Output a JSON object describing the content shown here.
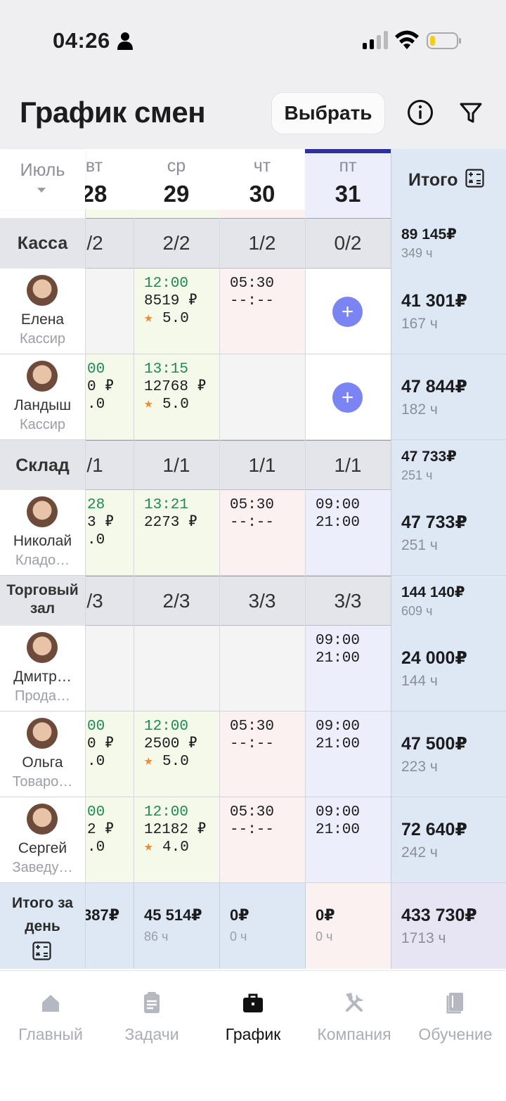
{
  "status_bar": {
    "time": "04:26"
  },
  "header": {
    "title": "График смен",
    "select_label": "Выбрать"
  },
  "month": {
    "label": "Июль"
  },
  "days": [
    {
      "name": "вт",
      "num": "28"
    },
    {
      "name": "ср",
      "num": "29"
    },
    {
      "name": "чт",
      "num": "30"
    },
    {
      "name": "пт",
      "num": "31"
    }
  ],
  "total_header": "Итого",
  "sections": [
    {
      "name": "Касса",
      "ratios": [
        "/2",
        "2/2",
        "1/2",
        "0/2"
      ],
      "total_sum": "89 145₽",
      "total_hours": "349 ч",
      "employees": [
        {
          "name": "Елена",
          "role": "Кассир",
          "cells": [
            {
              "lines": []
            },
            {
              "time": "12:00",
              "lines": [
                "8519 ₽"
              ],
              "rating": "5.0"
            },
            {
              "time_plain": "05:30",
              "lines": [
                "--:--"
              ]
            },
            {
              "add": "+"
            }
          ],
          "total_sum": "41 301₽",
          "total_hours": "167 ч"
        },
        {
          "name": "Ландыш",
          "role": "Кассир",
          "cells": [
            {
              "time": "00",
              "lines": [
                "0 ₽",
                ".0"
              ]
            },
            {
              "time": "13:15",
              "lines": [
                "12768 ₽"
              ],
              "rating": "5.0"
            },
            {
              "lines": []
            },
            {
              "add": "+"
            }
          ],
          "total_sum": "47 844₽",
          "total_hours": "182 ч"
        }
      ]
    },
    {
      "name": "Склад",
      "ratios": [
        "/1",
        "1/1",
        "1/1",
        "1/1"
      ],
      "total_sum": "47 733₽",
      "total_hours": "251 ч",
      "employees": [
        {
          "name": "Николай",
          "role": "Кладо…",
          "cells": [
            {
              "time": "28",
              "lines": [
                "3 ₽",
                ".0"
              ]
            },
            {
              "time": "13:21",
              "lines": [
                "2273 ₽"
              ]
            },
            {
              "time_plain": "05:30",
              "lines": [
                "--:--"
              ]
            },
            {
              "time_plain": "09:00",
              "lines": [
                "21:00"
              ]
            }
          ],
          "total_sum": "47 733₽",
          "total_hours": "251 ч"
        }
      ]
    },
    {
      "name": "Торговый зал",
      "ratios": [
        "/3",
        "2/3",
        "3/3",
        "3/3"
      ],
      "total_sum": "144 140₽",
      "total_hours": "609 ч",
      "employees": [
        {
          "name": "Дмитр…",
          "role": "Прода…",
          "cells": [
            {
              "lines": []
            },
            {
              "lines": []
            },
            {
              "lines": []
            },
            {
              "time_plain": "09:00",
              "lines": [
                "21:00"
              ]
            }
          ],
          "total_sum": "24 000₽",
          "total_hours": "144 ч"
        },
        {
          "name": "Ольга",
          "role": "Товаро…",
          "cells": [
            {
              "time": "00",
              "lines": [
                "0 ₽",
                ".0"
              ]
            },
            {
              "time": "12:00",
              "lines": [
                "2500 ₽"
              ],
              "rating": "5.0"
            },
            {
              "time_plain": "05:30",
              "lines": [
                "--:--"
              ]
            },
            {
              "time_plain": "09:00",
              "lines": [
                "21:00"
              ]
            }
          ],
          "total_sum": "47 500₽",
          "total_hours": "223 ч"
        },
        {
          "name": "Сергей",
          "role": "Заведу…",
          "cells": [
            {
              "time": "00",
              "lines": [
                "2 ₽",
                ".0"
              ]
            },
            {
              "time": "12:00",
              "lines": [
                "12182 ₽"
              ],
              "rating": "4.0"
            },
            {
              "time_plain": "05:30",
              "lines": [
                "--:--"
              ]
            },
            {
              "time_plain": "09:00",
              "lines": [
                "21:00"
              ]
            }
          ],
          "total_sum": "72 640₽",
          "total_hours": "242 ч"
        }
      ]
    }
  ],
  "day_totals": {
    "label": "Итого за день",
    "cells": [
      {
        "sum": "387₽",
        "hours": ""
      },
      {
        "sum": "45 514₽",
        "hours": "86 ч"
      },
      {
        "sum": "0₽",
        "hours": "0 ч"
      },
      {
        "sum": "0₽",
        "hours": "0 ч"
      }
    ],
    "grand_sum": "433 730₽",
    "grand_hours": "1713 ч"
  },
  "nav": [
    {
      "label": "Главный",
      "icon": "home-icon"
    },
    {
      "label": "Задачи",
      "icon": "clipboard-icon"
    },
    {
      "label": "График",
      "icon": "briefcase-icon"
    },
    {
      "label": "Компания",
      "icon": "tools-icon"
    },
    {
      "label": "Обучение",
      "icon": "book-icon"
    }
  ],
  "colors": {
    "accent": "#2f2fa0",
    "fri_bg": "#eceffb",
    "tue_green": "#f4f9ea",
    "thu_pink": "#fcf1f1",
    "total_col": "#dde8f4",
    "section_bg": "#e3e5ea",
    "plus": "#7b84f3"
  }
}
